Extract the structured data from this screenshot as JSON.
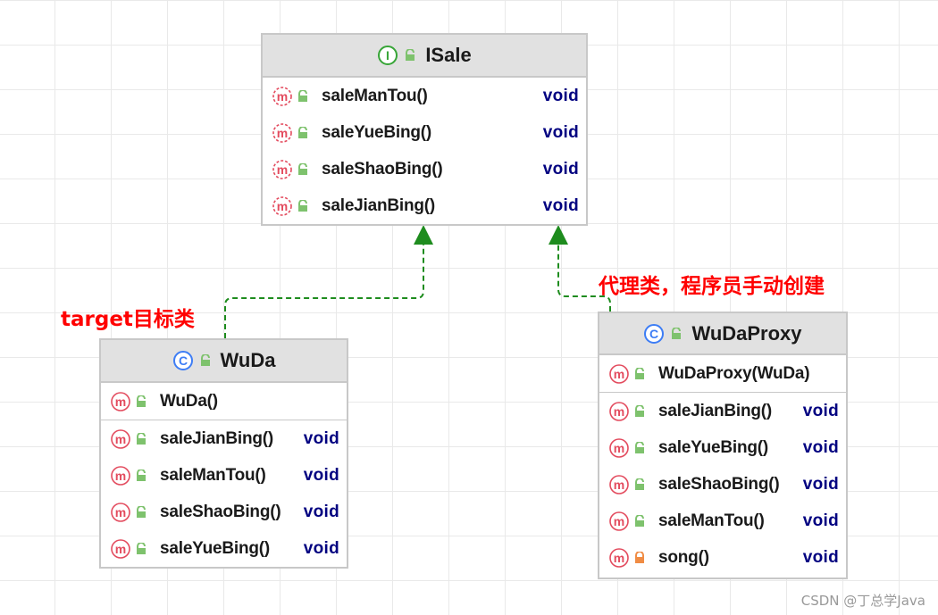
{
  "interface_box": {
    "name": "ISale",
    "kind_icon": "interface-icon",
    "methods": [
      {
        "name": "saleManTou()",
        "type": "void",
        "visibility": "public"
      },
      {
        "name": "saleYueBing()",
        "type": "void",
        "visibility": "public"
      },
      {
        "name": "saleShaoBing()",
        "type": "void",
        "visibility": "public"
      },
      {
        "name": "saleJianBing()",
        "type": "void",
        "visibility": "public"
      }
    ]
  },
  "target_box": {
    "name": "WuDa",
    "kind_icon": "class-icon",
    "constructor": {
      "name": "WuDa()",
      "type": ""
    },
    "methods": [
      {
        "name": "saleJianBing()",
        "type": "void",
        "visibility": "public"
      },
      {
        "name": "saleManTou()",
        "type": "void",
        "visibility": "public"
      },
      {
        "name": "saleShaoBing()",
        "type": "void",
        "visibility": "public"
      },
      {
        "name": "saleYueBing()",
        "type": "void",
        "visibility": "public"
      }
    ]
  },
  "proxy_box": {
    "name": "WuDaProxy",
    "kind_icon": "class-icon",
    "constructor": {
      "name": "WuDaProxy(WuDa)",
      "type": ""
    },
    "methods": [
      {
        "name": "saleJianBing()",
        "type": "void",
        "visibility": "public"
      },
      {
        "name": "saleYueBing()",
        "type": "void",
        "visibility": "public"
      },
      {
        "name": "saleShaoBing()",
        "type": "void",
        "visibility": "public"
      },
      {
        "name": "saleManTou()",
        "type": "void",
        "visibility": "public"
      },
      {
        "name": "song()",
        "type": "void",
        "visibility": "private"
      }
    ]
  },
  "annotations": {
    "target_label": "target目标类",
    "proxy_label": "代理类，程序员手动创建"
  },
  "watermark": "CSDN @丁总学Java",
  "colors": {
    "method_icon": "#e34b5e",
    "class_icon": "#3d7df5",
    "interface_icon": "#37a537",
    "public_lock": "#7ec26d",
    "private_lock": "#f08c44",
    "return_type": "#000080",
    "annotation": "#ff0000",
    "arrow": "#1e8c1e",
    "header_bg": "#e1e1e1"
  }
}
